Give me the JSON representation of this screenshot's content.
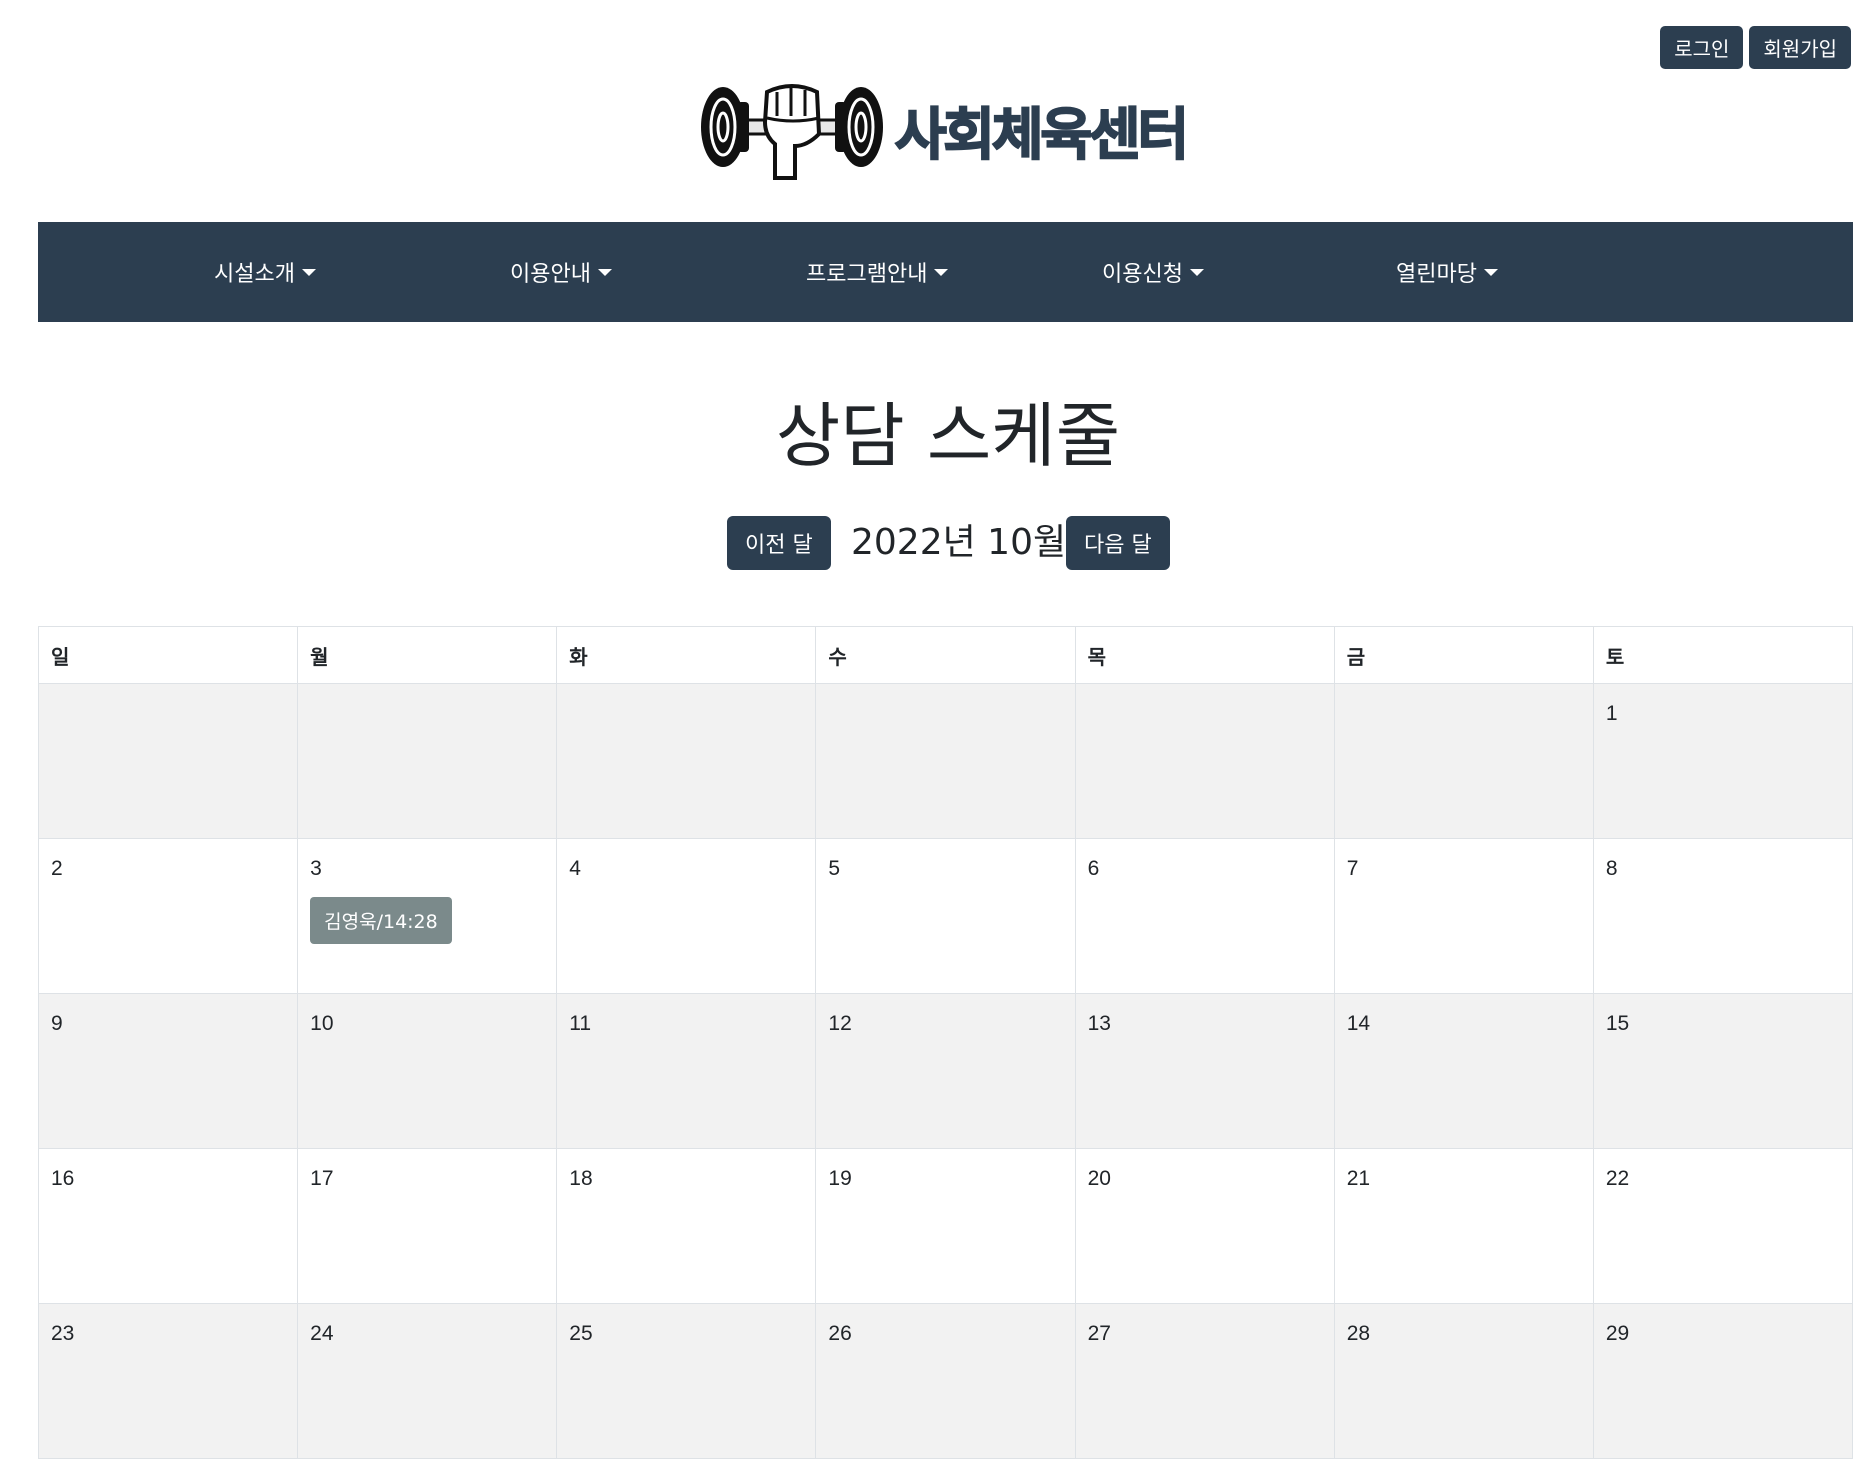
{
  "header": {
    "login_label": "로그인",
    "signup_label": "회원가입",
    "logo_text": "사회체육센터",
    "logo_icon": "dumbbell-fist-icon"
  },
  "nav": {
    "items": [
      {
        "label": "시설소개"
      },
      {
        "label": "이용안내"
      },
      {
        "label": "프로그램안내"
      },
      {
        "label": "이용신청"
      },
      {
        "label": "열린마당"
      }
    ]
  },
  "page": {
    "title": "상담 스케줄",
    "prev_label": "이전 달",
    "next_label": "다음 달",
    "month_label": "2022년 10월"
  },
  "calendar": {
    "weekdays": [
      "일",
      "월",
      "화",
      "수",
      "목",
      "금",
      "토"
    ],
    "weeks": [
      [
        "",
        "",
        "",
        "",
        "",
        "",
        "1"
      ],
      [
        "2",
        "3",
        "4",
        "5",
        "6",
        "7",
        "8"
      ],
      [
        "9",
        "10",
        "11",
        "12",
        "13",
        "14",
        "15"
      ],
      [
        "16",
        "17",
        "18",
        "19",
        "20",
        "21",
        "22"
      ],
      [
        "23",
        "24",
        "25",
        "26",
        "27",
        "28",
        "29"
      ]
    ],
    "events": [
      {
        "week": 1,
        "day": 1,
        "label": "김영욱/14:28"
      }
    ]
  },
  "colors": {
    "primary": "#2c3e50",
    "badge": "#7b8a8b",
    "stripe": "#f2f2f2"
  }
}
